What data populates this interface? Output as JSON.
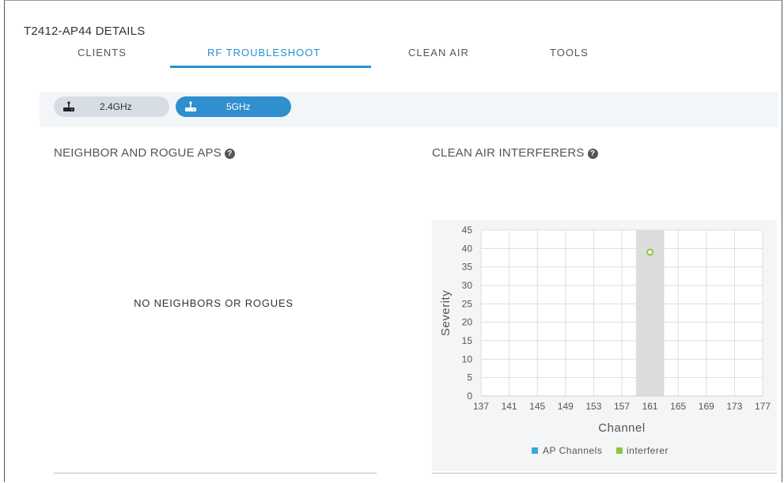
{
  "header": {
    "title": "T2412-AP44  DETAILS"
  },
  "tabs": [
    {
      "label": "CLIENTS",
      "active": false
    },
    {
      "label": "RF TROUBLESHOOT",
      "active": true
    },
    {
      "label": "CLEAN AIR",
      "active": false
    },
    {
      "label": "TOOLS",
      "active": false
    }
  ],
  "bands": [
    {
      "label": "2.4GHz",
      "selected": false
    },
    {
      "label": "5GHz",
      "selected": true
    }
  ],
  "neighbors": {
    "title": "NEIGHBOR AND ROGUE APS",
    "empty_message": "NO NEIGHBORS OR ROGUES"
  },
  "clean_air": {
    "title": "CLEAN AIR INTERFERERS"
  },
  "colors": {
    "accent": "#2a8fcf",
    "ap_channel": "#3ba6dc",
    "interferer": "#8cc63f"
  },
  "chart_data": {
    "type": "scatter",
    "xlabel": "Channel",
    "ylabel": "Severity",
    "x_ticks": [
      137,
      141,
      145,
      149,
      153,
      157,
      161,
      165,
      169,
      173,
      177
    ],
    "y_ticks": [
      0,
      5,
      10,
      15,
      20,
      25,
      30,
      35,
      40,
      45
    ],
    "xlim": [
      137,
      177
    ],
    "ylim": [
      0,
      45
    ],
    "grid": true,
    "ap_channel_band": [
      159,
      163
    ],
    "series": [
      {
        "name": "AP Channels",
        "points": []
      },
      {
        "name": "interferer",
        "points": [
          {
            "x": 161,
            "y": 39
          }
        ]
      }
    ],
    "legend": [
      "AP Channels",
      "interferer"
    ],
    "legend_position": "bottom"
  }
}
